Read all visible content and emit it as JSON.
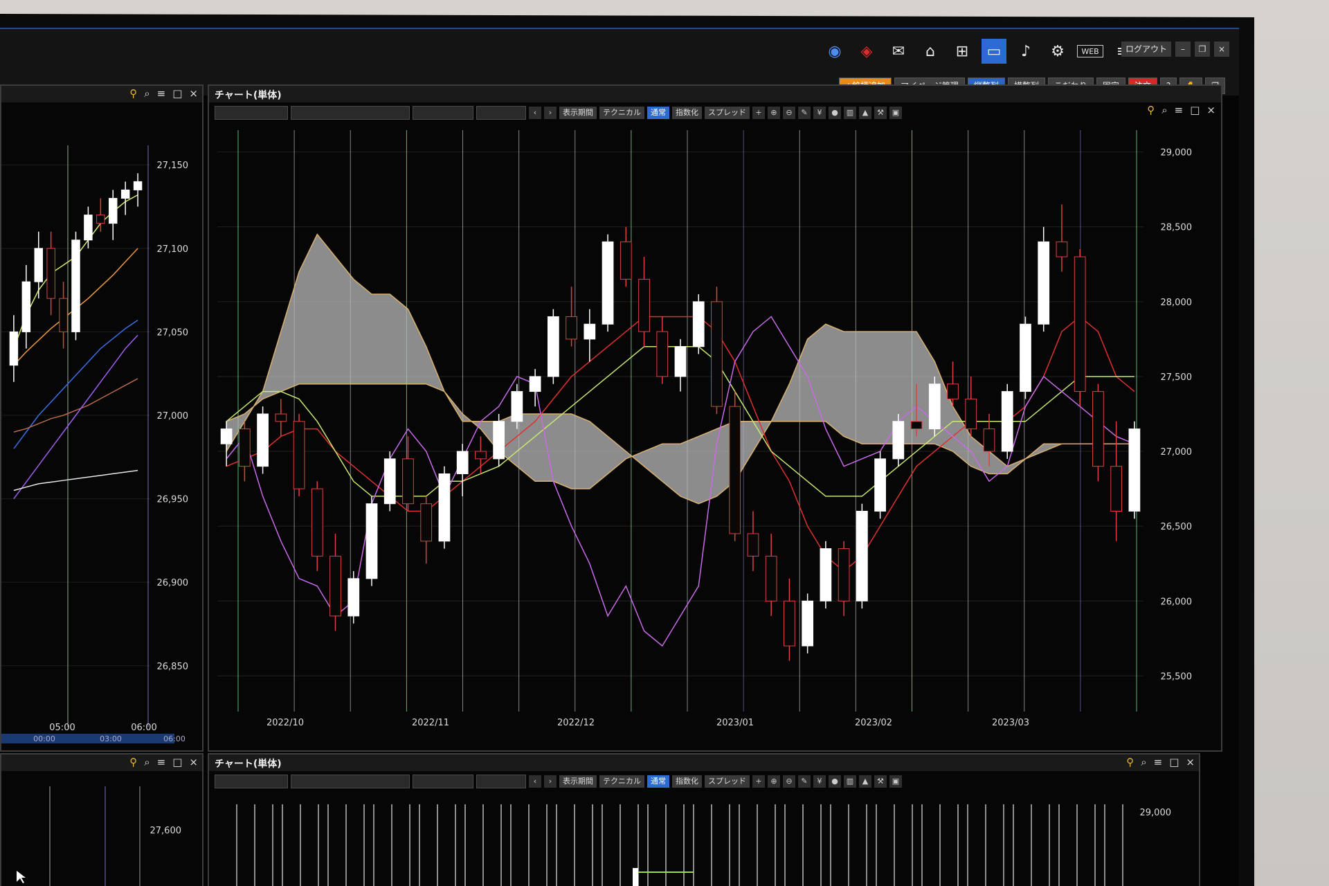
{
  "topbar": {
    "icons": [
      "chart-icon",
      "trend-icon",
      "message-icon",
      "home-icon",
      "add-window-icon",
      "layout-icon",
      "bell-icon",
      "gear-icon",
      "web-icon",
      "menu-icon"
    ],
    "web_label": "WEB",
    "logout_label": "ログアウト",
    "menu_buttons": [
      "+銘柄追加",
      "マイページ管理",
      "縦整列",
      "横整列",
      "こだわり",
      "固定",
      "注文"
    ],
    "accent": "#2b6bd3",
    "order_color": "#d42a2a"
  },
  "main_panel": {
    "title": "チャート(単体)",
    "toolbar_buttons": [
      "表示期間",
      "テクニカル",
      "通常",
      "指数化",
      "スプレッド"
    ],
    "y_ticks": [
      "29,000",
      "28,500",
      "28,000",
      "27,500",
      "27,000",
      "26,500",
      "26,000",
      "25,500"
    ],
    "x_ticks": [
      "2022/10",
      "2022/11",
      "2022/12",
      "2023/01",
      "2023/02",
      "2023/03"
    ]
  },
  "left_panel": {
    "y_ticks": [
      "27,150",
      "27,100",
      "27,050",
      "27,000",
      "26,950",
      "26,900",
      "26,850"
    ],
    "x_ticks": [
      "05:00",
      "06:00"
    ],
    "x_sub_ticks": [
      "00:00",
      "03:00",
      "06:00"
    ]
  },
  "bottom_panel": {
    "title": "チャート(単体)",
    "toolbar_buttons": [
      "表示期間",
      "テクニカル",
      "通常",
      "指数化",
      "スプレッド"
    ],
    "y_ticks": [
      "29,000"
    ]
  },
  "bottom_left_panel": {
    "y_ticks": [
      "27,600"
    ]
  },
  "chart_data": [
    {
      "type": "candlestick",
      "ylim": [
        25400,
        29100
      ],
      "x_ticks": [
        "2022/10",
        "2022/11",
        "2022/12",
        "2023/01",
        "2023/02",
        "2023/03"
      ],
      "y_ticks": [
        29000,
        28500,
        28000,
        27500,
        27000,
        26500,
        26000,
        25500
      ],
      "grid": true,
      "candles": [
        [
          27050,
          27200,
          26900,
          27150
        ],
        [
          27150,
          27200,
          26800,
          26900
        ],
        [
          26900,
          27300,
          26850,
          27250
        ],
        [
          27250,
          27350,
          27100,
          27200
        ],
        [
          27200,
          27250,
          26700,
          26750
        ],
        [
          26750,
          26800,
          26200,
          26300
        ],
        [
          26300,
          26450,
          25800,
          25900
        ],
        [
          25900,
          26200,
          25850,
          26150
        ],
        [
          26150,
          26700,
          26100,
          26650
        ],
        [
          26650,
          27000,
          26600,
          26950
        ],
        [
          26950,
          27100,
          26600,
          26650
        ],
        [
          26650,
          26700,
          26250,
          26400
        ],
        [
          26400,
          26900,
          26350,
          26850
        ],
        [
          26850,
          27050,
          26700,
          27000
        ],
        [
          27000,
          27100,
          26850,
          26950
        ],
        [
          26950,
          27250,
          26900,
          27200
        ],
        [
          27200,
          27450,
          27150,
          27400
        ],
        [
          27400,
          27550,
          27300,
          27500
        ],
        [
          27500,
          27950,
          27450,
          27900
        ],
        [
          27900,
          28100,
          27700,
          27750
        ],
        [
          27750,
          27950,
          27600,
          27850
        ],
        [
          27850,
          28450,
          27800,
          28400
        ],
        [
          28400,
          28500,
          28100,
          28150
        ],
        [
          28150,
          28300,
          27700,
          27800
        ],
        [
          27800,
          27900,
          27450,
          27500
        ],
        [
          27500,
          27750,
          27400,
          27700
        ],
        [
          27700,
          28050,
          27650,
          28000
        ],
        [
          28000,
          28100,
          27250,
          27300
        ],
        [
          27300,
          27400,
          26400,
          26450
        ],
        [
          26450,
          26600,
          26200,
          26300
        ],
        [
          26300,
          26450,
          25900,
          26000
        ],
        [
          26000,
          26150,
          25600,
          25700
        ],
        [
          25700,
          26050,
          25650,
          26000
        ],
        [
          26000,
          26400,
          25950,
          26350
        ],
        [
          26350,
          26400,
          25900,
          26000
        ],
        [
          26000,
          26650,
          25950,
          26600
        ],
        [
          26600,
          27000,
          26550,
          26950
        ],
        [
          26950,
          27250,
          26900,
          27200
        ],
        [
          27200,
          27450,
          27100,
          27150
        ],
        [
          27150,
          27500,
          27100,
          27450
        ],
        [
          27450,
          27600,
          27300,
          27350
        ],
        [
          27350,
          27500,
          27100,
          27150
        ],
        [
          27150,
          27250,
          26900,
          27000
        ],
        [
          27000,
          27450,
          26950,
          27400
        ],
        [
          27400,
          27900,
          27350,
          27850
        ],
        [
          27850,
          28500,
          27800,
          28400
        ],
        [
          28400,
          28650,
          28200,
          28300
        ],
        [
          28300,
          28350,
          27300,
          27400
        ],
        [
          27400,
          27450,
          26800,
          26900
        ],
        [
          26900,
          27200,
          26400,
          26600
        ],
        [
          26600,
          27200,
          26550,
          27150
        ]
      ],
      "series": [
        {
          "values": [
            26900,
            26950,
            27000,
            27100,
            27150,
            27150,
            27000,
            26900,
            26800,
            26700,
            26600,
            26600,
            26700,
            26800,
            26900,
            27000,
            27100,
            27200,
            27350,
            27500,
            27600,
            27700,
            27800,
            27900,
            27900,
            27900,
            27900,
            27800,
            27600,
            27300,
            27000,
            26800,
            26500,
            26300,
            26200,
            26300,
            26500,
            26700,
            26900,
            27000,
            27100,
            27200,
            27200,
            27200,
            27300,
            27500,
            27800,
            27900,
            27800,
            27500,
            27400
          ]
        },
        {
          "values": [
            27200,
            27300,
            27400,
            27400,
            27350,
            27200,
            27000,
            26800,
            26700,
            26700,
            26700,
            26700,
            26800,
            26800,
            26850,
            26900,
            27000,
            27100,
            27200,
            27300,
            27400,
            27500,
            27600,
            27700,
            27700,
            27700,
            27700,
            27600,
            27400,
            27200,
            27000,
            26900,
            26800,
            26700,
            26700,
            26700,
            26800,
            26900,
            27000,
            27100,
            27200,
            27200,
            27200,
            27200,
            27200,
            27300,
            27400,
            27500,
            27500,
            27500,
            27500
          ]
        },
        {
          "values": [
            26950,
            27100,
            26700,
            26400,
            26150,
            26100,
            25900,
            26000,
            26650,
            26950,
            27150,
            27000,
            26700,
            26950,
            27200,
            27300,
            27500,
            27450,
            26800,
            26500,
            26250,
            25900,
            26100,
            25800,
            25700,
            25900,
            26100,
            27050,
            27600,
            27800,
            27900,
            27700,
            27500,
            27150,
            26900,
            26950,
            27000,
            27200,
            27300,
            27200,
            27100,
            27000,
            26800,
            26900,
            27300,
            27500,
            27400,
            27300,
            27200,
            27100,
            27050
          ]
        }
      ],
      "cloud_a": [
        27000,
        27200,
        27400,
        27800,
        28200,
        28450,
        28300,
        28150,
        28050,
        28050,
        27950,
        27700,
        27400,
        27200,
        27200,
        27200,
        27250,
        27250,
        27250,
        27250,
        27200,
        27100,
        27000,
        26900,
        26800,
        26700,
        26650,
        26700,
        26800,
        27000,
        27200,
        27450,
        27750,
        27850,
        27800,
        27800,
        27800,
        27800,
        27800,
        27600,
        27300,
        27100,
        27000,
        26900,
        26950,
        27000,
        27050,
        27050,
        27050,
        27050,
        27050
      ],
      "cloud_b": [
        27200,
        27250,
        27350,
        27400,
        27450,
        27450,
        27450,
        27450,
        27450,
        27450,
        27450,
        27450,
        27400,
        27250,
        27150,
        27000,
        26900,
        26800,
        26800,
        26750,
        26750,
        26850,
        26950,
        27000,
        27050,
        27050,
        27100,
        27150,
        27200,
        27200,
        27200,
        27200,
        27200,
        27200,
        27100,
        27050,
        27050,
        27050,
        27050,
        27050,
        27000,
        26900,
        26850,
        26850,
        26950,
        27050,
        27050,
        27050,
        27050,
        27050,
        27050
      ]
    },
    {
      "type": "candlestick",
      "ylim": [
        26830,
        27170
      ],
      "x_ticks": [
        "05:00",
        "06:00"
      ],
      "y_ticks": [
        27150,
        27100,
        27050,
        27000,
        26950,
        26900,
        26850
      ],
      "grid": true,
      "candles": [
        [
          27030,
          27060,
          27020,
          27050
        ],
        [
          27050,
          27090,
          27040,
          27080
        ],
        [
          27080,
          27110,
          27070,
          27100
        ],
        [
          27100,
          27110,
          27060,
          27070
        ],
        [
          27070,
          27080,
          27040,
          27050
        ],
        [
          27050,
          27110,
          27045,
          27105
        ],
        [
          27105,
          27125,
          27100,
          27120
        ],
        [
          27120,
          27130,
          27110,
          27115
        ],
        [
          27115,
          27135,
          27105,
          27130
        ],
        [
          27130,
          27140,
          27120,
          27135
        ],
        [
          27135,
          27145,
          27125,
          27140
        ]
      ],
      "series": [
        {
          "values": [
            27040,
            27060,
            27075,
            27085,
            27090,
            27095,
            27105,
            27115,
            27122,
            27128,
            27132
          ]
        },
        {
          "values": [
            27030,
            27038,
            27045,
            27052,
            27058,
            27064,
            27070,
            27077,
            27084,
            27092,
            27100
          ]
        },
        {
          "values": [
            26980,
            26990,
            27000,
            27008,
            27016,
            27024,
            27032,
            27040,
            27046,
            27052,
            27057
          ]
        },
        {
          "values": [
            26990,
            26992,
            26995,
            26998,
            27000,
            27003,
            27006,
            27010,
            27014,
            27018,
            27022
          ]
        },
        {
          "values": [
            26950,
            26960,
            26970,
            26980,
            26990,
            27000,
            27010,
            27020,
            27030,
            27040,
            27048
          ]
        },
        {
          "values": [
            26955,
            26957,
            26959,
            26960,
            26961,
            26962,
            26963,
            26964,
            26965,
            26966,
            26967
          ]
        }
      ]
    }
  ]
}
